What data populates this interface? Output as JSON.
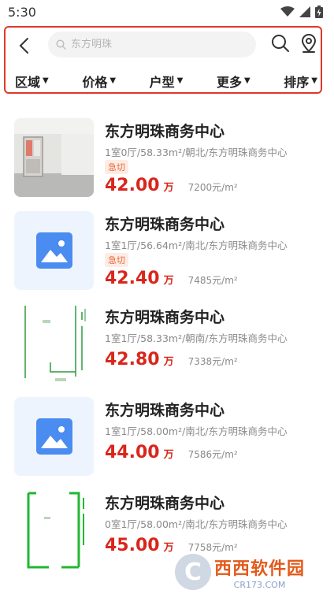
{
  "status_bar": {
    "time": "5:30"
  },
  "header": {
    "search_placeholder": "东方明珠",
    "filters": [
      "区域",
      "价格",
      "户型",
      "更多",
      "排序"
    ]
  },
  "listings": [
    {
      "title": "东方明珠商务中心",
      "desc": "1室0厅/58.33m²/朝北/东方明珠商务中心",
      "tag": "急切",
      "price": "42.00",
      "price_unit": "万",
      "unit_price": "7200元/m²",
      "thumb": "photo"
    },
    {
      "title": "东方明珠商务中心",
      "desc": "1室1厅/56.64m²/南北/东方明珠商务中心",
      "tag": "急切",
      "price": "42.40",
      "price_unit": "万",
      "unit_price": "7485元/m²",
      "thumb": "image-placeholder"
    },
    {
      "title": "东方明珠商务中心",
      "desc": "1室1厅/58.33m²/朝南/东方明珠商务中心",
      "tag": "",
      "price": "42.80",
      "price_unit": "万",
      "unit_price": "7338元/m²",
      "thumb": "floor-plan"
    },
    {
      "title": "东方明珠商务中心",
      "desc": "1室1厅/58.00m²/南北/东方明珠商务中心",
      "tag": "",
      "price": "44.00",
      "price_unit": "万",
      "unit_price": "7586元/m²",
      "thumb": "image-placeholder"
    },
    {
      "title": "东方明珠商务中心",
      "desc": "0室1厅/58.00m²/南北/东方明珠商务中心",
      "tag": "",
      "price": "45.00",
      "price_unit": "万",
      "unit_price": "7758元/m²",
      "thumb": "floor-plan"
    }
  ],
  "watermark": {
    "logo_char": "C",
    "name": "西西软件园",
    "url": "CR173.COM"
  },
  "colors": {
    "accent_red": "#d9261c",
    "highlight_border": "#e0382b",
    "placeholder_blue": "#4a8cf0"
  }
}
